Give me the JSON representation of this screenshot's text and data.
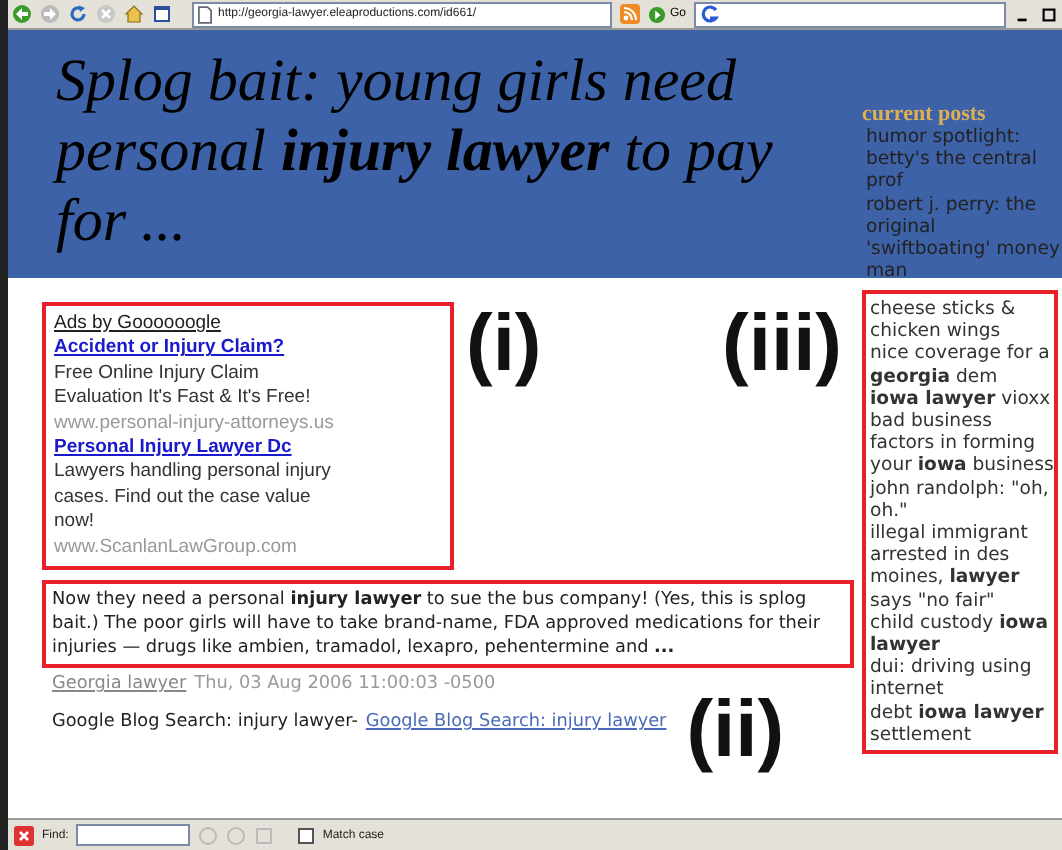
{
  "browser": {
    "url": "http://georgia-lawyer.eleaproductions.com/id661/",
    "go_label": "Go"
  },
  "page": {
    "title": "Splog bait: young girls need personal **injury lawyer** to pay for ...",
    "sidebar": {
      "heading": "current posts",
      "posts": [
        "humor spotlight: betty's the central prof",
        "robert j. perry: the original 'swiftboating' money man"
      ],
      "annotated": {
        "label": "(iii)",
        "posts": [
          "cheese sticks & chicken wings",
          "nice coverage for a **georgia** dem",
          "**iowa lawyer** vioxx",
          "bad business factors in forming your **iowa** business",
          "john randolph: \"oh, oh.\"",
          "illegal immigrant arrested in des moines, **lawyer** says \"no fair\"",
          "child custody **iowa lawyer**",
          "dui: driving using internet",
          "debt **iowa lawyer** settlement"
        ]
      }
    },
    "ads": {
      "label": "(i)",
      "heading": "Ads by Goooooogle",
      "items": [
        {
          "title": "Accident or Injury Claim?",
          "description": "Free Online Injury Claim Evaluation It's Fast & It's Free!",
          "url": "www.personal-injury-attorneys.us"
        },
        {
          "title": "Personal Injury Lawyer Dc",
          "description": "Lawyers handling personal injury cases. Find out the case value now!",
          "url": "www.ScanlanLawGroup.com"
        }
      ]
    },
    "post": {
      "label": "(ii)",
      "excerpt": "Now they need a personal **injury lawyer** to sue the bus company! (Yes, this is splog bait.) The poor girls will have to take brand-name, FDA approved medications for their injuries — drugs like ambien, tramadol, lexapro, pehentermine and **...**",
      "source_link": "Georgia lawyer",
      "date": "Thu, 03 Aug 2006 11:00:03 -0500",
      "search_text": "Google Blog Search: injury lawyer-",
      "search_link": "Google Blog Search: injury lawyer"
    }
  },
  "find_bar": {
    "label": "Find:",
    "match_case": {
      "label": "Match case",
      "checked": false
    }
  }
}
